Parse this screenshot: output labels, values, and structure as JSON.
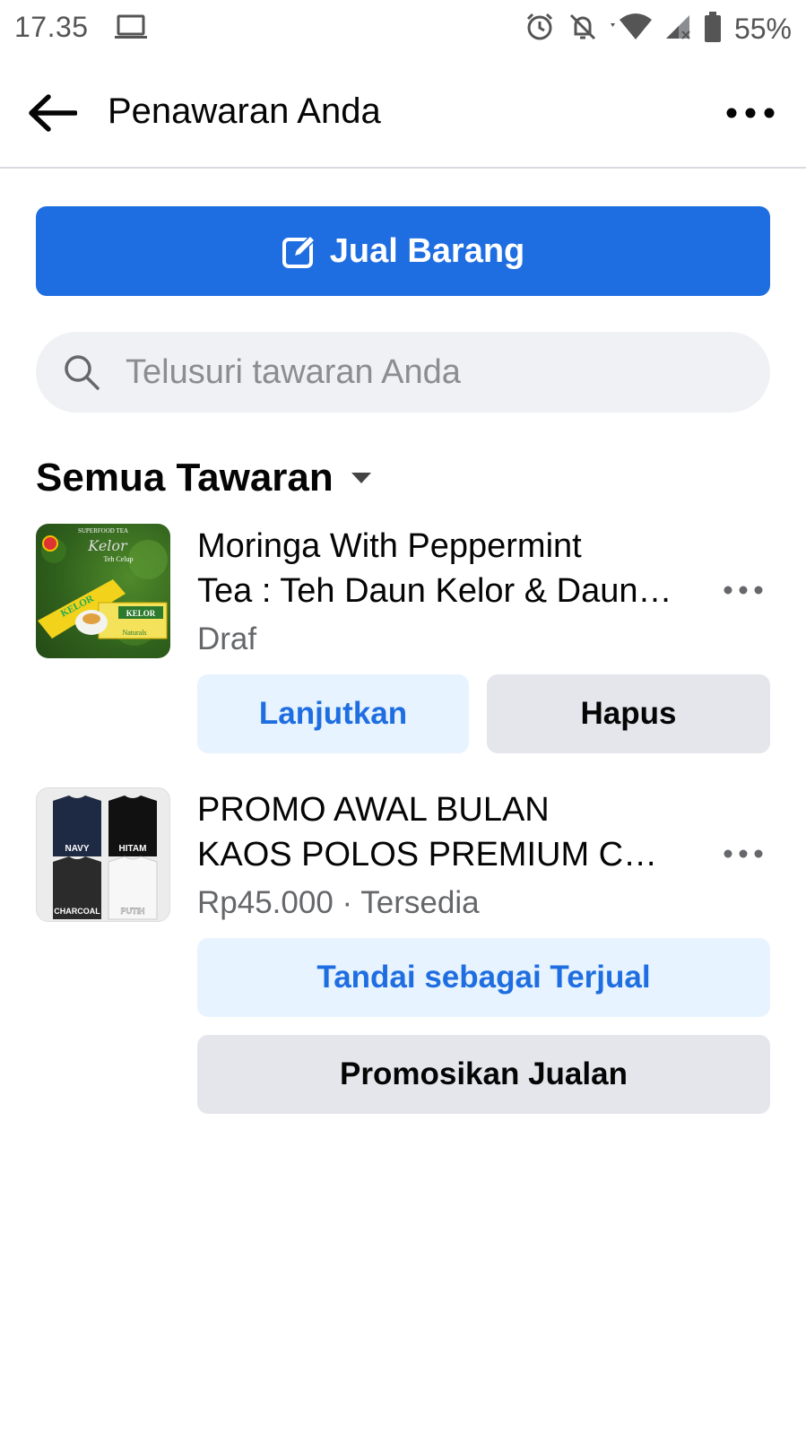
{
  "status_bar": {
    "time": "17.35",
    "battery_percent": "55%",
    "icons": [
      "laptop-icon",
      "alarm-icon",
      "notifications-off-icon",
      "wifi-icon",
      "signal-icon",
      "battery-icon"
    ]
  },
  "app_bar": {
    "title": "Penawaran Anda",
    "back_icon": "arrow-left-icon",
    "more_icon": "more-horizontal-icon"
  },
  "sell_button": {
    "label": "Jual Barang",
    "icon": "edit-icon",
    "color": "#1f6ee1"
  },
  "search": {
    "placeholder": "Telusuri tawaran Anda",
    "value": ""
  },
  "section": {
    "title": "Semua Tawaran",
    "dropdown_icon": "caret-down-icon"
  },
  "listings": [
    {
      "title_line1": "Moringa With Peppermint",
      "title_line2": "Tea : Teh Daun Kelor & Daun Mint",
      "meta": "Draf",
      "thumb_top_text": "SUPERFOOD TEA",
      "thumb_brand": "KELOR",
      "thumb_sub": "Teh Celup",
      "actions": [
        "Lanjutkan",
        "Hapus"
      ]
    },
    {
      "title_line1": "PROMO AWAL BULAN",
      "title_line2": "KAOS POLOS PREMIUM COMBED",
      "meta": "Rp45.000 · Tersedia",
      "thumb_labels": [
        "NAVY",
        "HITAM",
        "CHARCOAL",
        "PUTIH"
      ],
      "actions": [
        "Tandai sebagai Terjual",
        "Promosikan Jualan"
      ]
    }
  ],
  "colors": {
    "primary": "#1f6ee1",
    "soft_primary_bg": "#e7f3ff",
    "gray_button_bg": "#e4e6eb",
    "search_bg": "#eff1f4",
    "secondary_text": "#65676b"
  }
}
